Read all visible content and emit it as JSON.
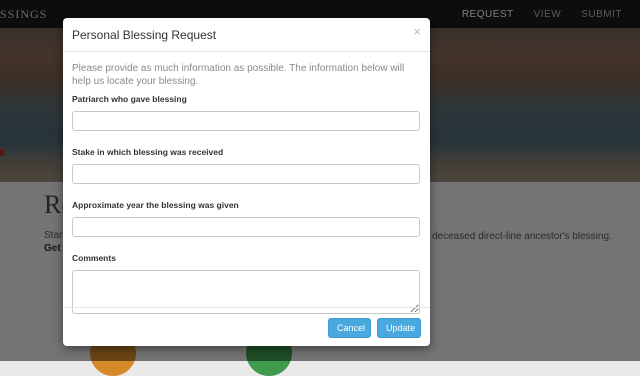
{
  "navbar": {
    "brand": "SSINGS",
    "links": [
      {
        "label": "REQUEST",
        "active": true
      },
      {
        "label": "VIEW",
        "active": false
      },
      {
        "label": "SUBMIT",
        "active": false
      }
    ]
  },
  "page": {
    "heading": "Re",
    "text_left": "Star",
    "text_left_bold": "Get",
    "text_right": "deceased direct-line ancestor's blessing."
  },
  "modal": {
    "title": "Personal Blessing Request",
    "close_glyph": "×",
    "intro": "Please provide as much information as possible. The information below will help us locate your blessing.",
    "fields": [
      {
        "label": "Patriarch who gave blessing",
        "value": "",
        "placeholder": ""
      },
      {
        "label": "Stake in which blessing was received",
        "value": "",
        "placeholder": ""
      },
      {
        "label": "Approximate year the blessing was given",
        "value": "",
        "placeholder": ""
      }
    ],
    "comments": {
      "label": "Comments",
      "value": "",
      "placeholder": ""
    },
    "buttons": {
      "cancel": "Cancel",
      "update": "Update"
    }
  },
  "colors": {
    "navbar_bg": "#1b1b1b",
    "button_primary": "#49a9df",
    "backdrop": "rgba(0,0,0,0.5)"
  }
}
